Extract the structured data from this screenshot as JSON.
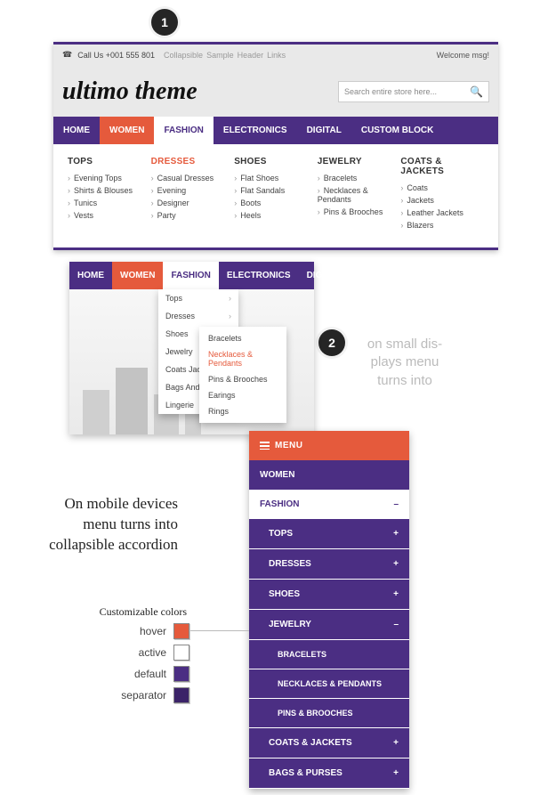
{
  "colors": {
    "purple": "#4b2e83",
    "orange": "#e55a3c",
    "white": "#ffffff",
    "sep": "#3b2368"
  },
  "badge1": "1",
  "badge2": "2",
  "panel1": {
    "call_label": "Call Us +001 555 801",
    "crumbs": [
      "Collapsible",
      "Sample",
      "Header",
      "Links"
    ],
    "welcome": "Welcome msg!",
    "logo": "ultimo theme",
    "search_placeholder": "Search entire store here...",
    "nav": [
      "HOME",
      "WOMEN",
      "FASHION",
      "ELECTRONICS",
      "DIGITAL",
      "CUSTOM BLOCK"
    ],
    "mega": [
      {
        "title": "TOPS",
        "items": [
          "Evening Tops",
          "Shirts & Blouses",
          "Tunics",
          "Vests"
        ]
      },
      {
        "title": "DRESSES",
        "hot": true,
        "items": [
          "Casual Dresses",
          "Evening",
          "Designer",
          "Party"
        ]
      },
      {
        "title": "SHOES",
        "items": [
          "Flat Shoes",
          "Flat Sandals",
          "Boots",
          "Heels"
        ]
      },
      {
        "title": "JEWELRY",
        "items": [
          "Bracelets",
          "Necklaces & Pendants",
          "Pins & Brooches"
        ]
      },
      {
        "title": "COATS & JACKETS",
        "items": [
          "Coats",
          "Jackets",
          "Leather Jackets",
          "Blazers"
        ]
      }
    ]
  },
  "panel2": {
    "nav": [
      "HOME",
      "WOMEN",
      "FASHION",
      "ELECTRONICS",
      "DIGITAL"
    ],
    "dd1": [
      "Tops",
      "Dresses",
      "Shoes",
      "Jewelry",
      "Coats Jac",
      "Bags And",
      "Lingerie"
    ],
    "dd2": [
      {
        "label": "Bracelets"
      },
      {
        "label": "Necklaces & Pendants",
        "hot": true
      },
      {
        "label": "Pins & Brooches"
      },
      {
        "label": "Earings"
      },
      {
        "label": "Rings"
      }
    ],
    "side_label": [
      "on small dis-",
      "plays menu",
      "turns into"
    ]
  },
  "panel3": {
    "menu": "MENU",
    "rows": [
      {
        "type": "women",
        "label": "WOMEN"
      },
      {
        "type": "fash",
        "label": "FASHION",
        "sign": "–"
      },
      {
        "type": "cat",
        "label": "TOPS",
        "sign": "+"
      },
      {
        "type": "cat",
        "label": "DRESSES",
        "sign": "+"
      },
      {
        "type": "cat",
        "label": "SHOES",
        "sign": "+"
      },
      {
        "type": "cat",
        "label": "JEWELRY",
        "sign": "–"
      },
      {
        "type": "sub",
        "label": "BRACELETS"
      },
      {
        "type": "sub",
        "label": "NECKLACES & PENDANTS"
      },
      {
        "type": "sub",
        "label": "PINS & BROOCHES"
      },
      {
        "type": "cat",
        "label": "COATS & JACKETS",
        "sign": "+"
      },
      {
        "type": "cat",
        "label": "BAGS & PURSES",
        "sign": "+"
      }
    ],
    "explain": "On mobile devices menu turns into collapsible accordion",
    "custom_colors": "Customizable colors",
    "swatches": [
      {
        "label": "hover",
        "color": "#e55a3c"
      },
      {
        "label": "active",
        "color": "#ffffff"
      },
      {
        "label": "default",
        "color": "#4b2e83"
      },
      {
        "label": "separator",
        "color": "#3b2368"
      }
    ]
  }
}
